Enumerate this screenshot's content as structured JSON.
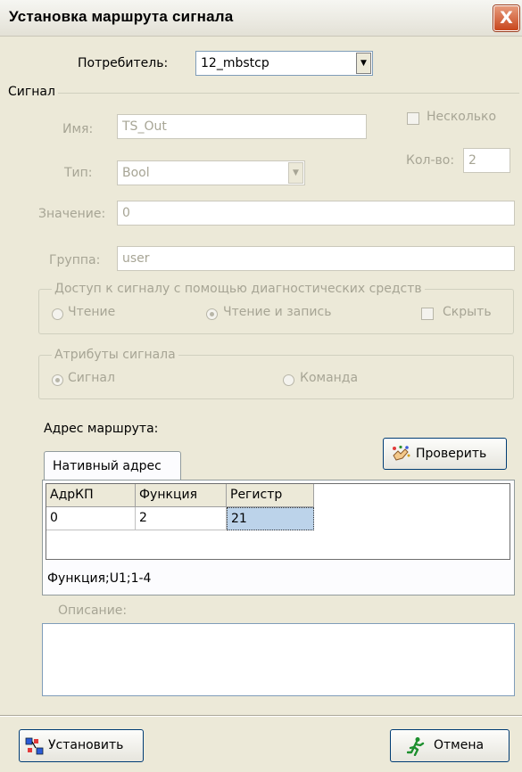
{
  "window": {
    "title": "Установка маршрута сигнала",
    "close_label": "X"
  },
  "consumer": {
    "label": "Потребитель:",
    "value": "12_mbstcp"
  },
  "signal_group": {
    "title": "Сигнал",
    "name_label": "Имя:",
    "name_value": "TS_Out",
    "multiple_label": "Несколько",
    "type_label": "Тип:",
    "type_value": "Bool",
    "count_label": "Кол-во:",
    "count_value": "2",
    "value_label": "Значение:",
    "value_value": "0",
    "group_label": "Группа:",
    "group_value": "user"
  },
  "diagnostic_access": {
    "title": "Доступ к сигналу с помощью диагностических средств",
    "read_label": "Чтение",
    "readwrite_label": "Чтение и запись",
    "hide_label": "Скрыть",
    "selected": "Чтение и запись"
  },
  "signal_attributes": {
    "title": "Атрибуты сигнала",
    "signal_label": "Сигнал",
    "command_label": "Команда",
    "selected": "Сигнал"
  },
  "route": {
    "label": "Адрес маршрута:",
    "verify_button": "Проверить",
    "tab_label": "Нативный адрес",
    "columns": [
      "АдрКП",
      "Функция",
      "Регистр"
    ],
    "row": [
      "0",
      "2",
      "21"
    ],
    "format_text": "Функция;U1;1-4"
  },
  "description": {
    "label": "Описание:",
    "value": ""
  },
  "footer": {
    "install_button": "Установить",
    "cancel_button": "Отмена"
  },
  "icons": {
    "verify": "sparkle-hand-icon",
    "install": "install-squares-icon",
    "cancel": "running-man-icon"
  }
}
